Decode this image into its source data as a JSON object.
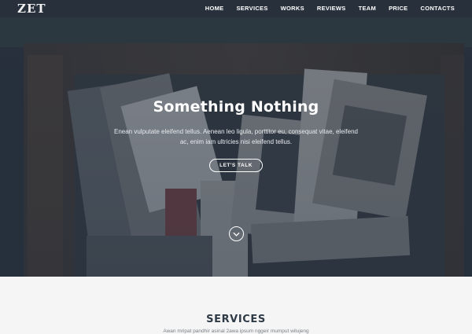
{
  "brand": {
    "logo": "ZET"
  },
  "nav": {
    "items": [
      {
        "label": "HOME"
      },
      {
        "label": "SERVICES"
      },
      {
        "label": "WORKS"
      },
      {
        "label": "REVIEWS"
      },
      {
        "label": "TEAM"
      },
      {
        "label": "PRICE"
      },
      {
        "label": "CONTACTS"
      }
    ]
  },
  "hero": {
    "title": "Something Nothing",
    "text": "Enean vulputate eleifend tellus. Aenean leo ligula, porttitor eu, consequat vitae, eleifend ac, enim iam ultricies nisi eleifend tellus.",
    "cta_label": "LET'S TALK",
    "scroll_icon": "chevron-down-icon"
  },
  "services": {
    "title": "SERVICES",
    "subtitle": "Awan mripat pandhir asinal 2awa ipsum nggeir mumput wilujeng"
  },
  "colors": {
    "nav_bg": "#28303c",
    "hero_overlay": "#2d3746",
    "services_bg": "#f5f5f5",
    "services_title": "#2f3a47"
  }
}
